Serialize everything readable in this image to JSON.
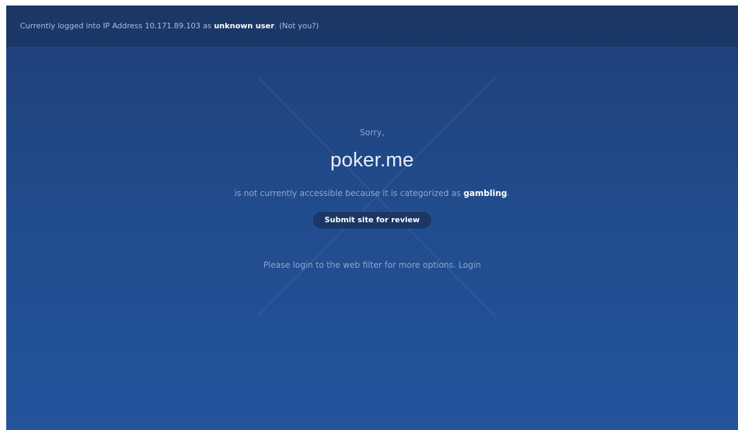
{
  "topbar": {
    "prefix": "Currently logged into IP Address 10.171.89.103 as ",
    "user": "unknown user",
    "period": ".",
    "not_you": "(Not you?)"
  },
  "block": {
    "sorry": "Sorry,",
    "domain": "poker.me",
    "reason_prefix": "is not currently accessible because it is categorized as ",
    "category": "gambling",
    "reason_suffix": ".",
    "submit_label": "Submit site for review",
    "login_prompt": "Please login to the web filter for more options.",
    "login_link": "Login"
  },
  "colors": {
    "background": "#214b8c",
    "topbar": "#1a3766",
    "button": "#1a3766",
    "muted_text": "#8fa6cc"
  }
}
